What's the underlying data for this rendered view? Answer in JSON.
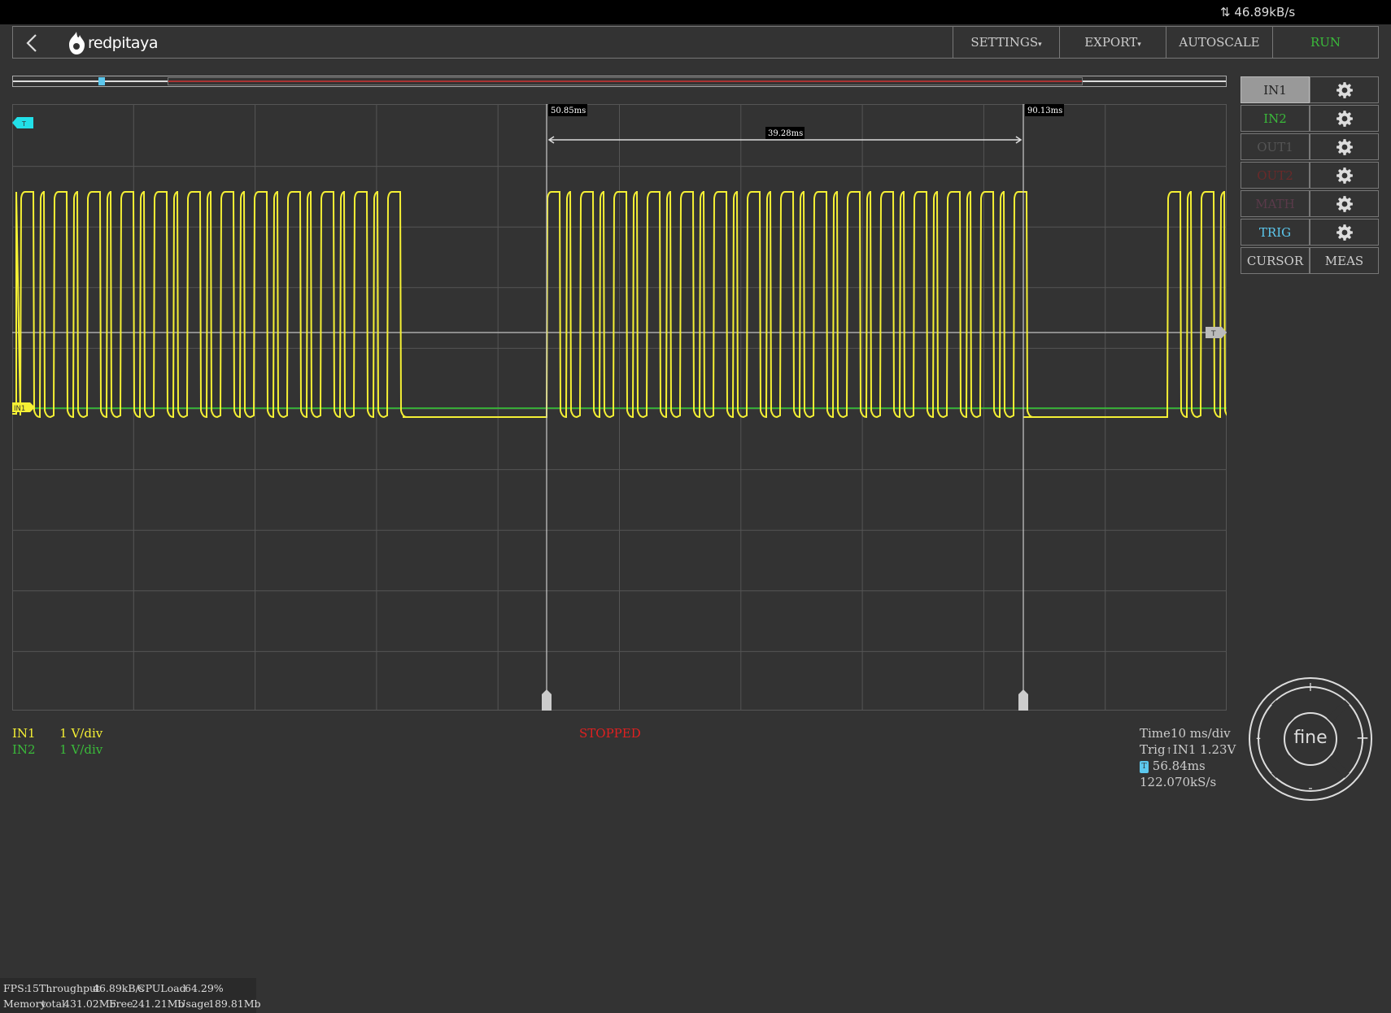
{
  "topbar": {
    "throughput": "46.89kB/s"
  },
  "nav": {
    "brand": "redpitaya",
    "settings": "SETTINGS",
    "export": "EXPORT",
    "autoscale": "AUTOSCALE",
    "run": "RUN"
  },
  "channels": {
    "in1": "IN1",
    "in2": "IN2",
    "out1": "OUT1",
    "out2": "OUT2",
    "math": "MATH",
    "trig": "TRIG",
    "cursor": "CURSOR",
    "meas": "MEAS"
  },
  "scope": {
    "cursor1": "50.85ms",
    "cursor2": "90.13ms",
    "cursor_delta": "39.28ms",
    "trigger_marker": "T",
    "in1_marker": "IN1",
    "trace_color": "#f5f034",
    "ref_color": "#33cc33"
  },
  "info": {
    "in1_label": "IN1",
    "in1_scale": "1 V/div",
    "in2_label": "IN2",
    "in2_scale": "1 V/div",
    "status": "STOPPED",
    "time_label": "Time",
    "time_value": "10 ms/div",
    "trig_label": "Trig",
    "trig_value": "IN1 1.23V",
    "trig_pos": "56.84ms",
    "sample_rate": "122.070kS/s"
  },
  "dial": {
    "center": "fine",
    "plus": "+",
    "minus": "-"
  },
  "stats": {
    "fps_label": "FPS:",
    "fps": "15",
    "throughput_label": "Throughput",
    "throughput": "46.89kB/s",
    "cpu_label": "CPULoad",
    "cpu": "64.29%",
    "mem_label": "Memory",
    "total_label": "total",
    "total": "431.02Mb",
    "free_label": "Free",
    "free": "241.21Mb",
    "usage_label": "Usage",
    "usage": "189.81Mb"
  }
}
